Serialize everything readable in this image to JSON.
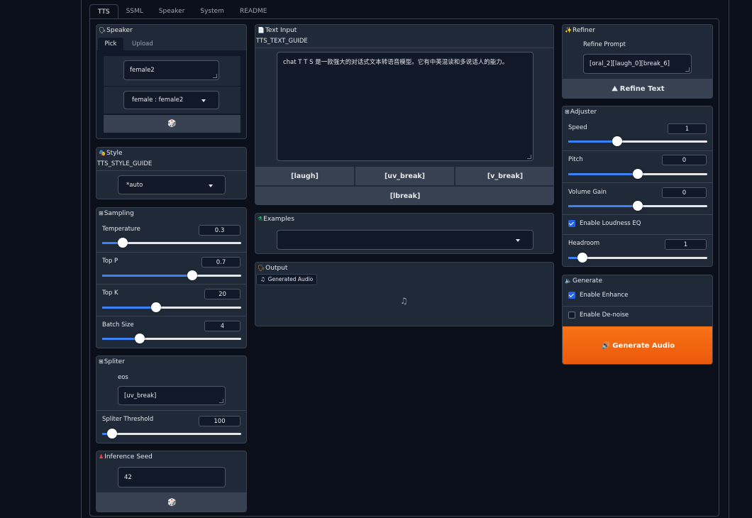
{
  "tabs": [
    "TTS",
    "SSML",
    "Speaker",
    "System",
    "README"
  ],
  "speaker": {
    "title": "Speaker",
    "subtabs": [
      "Pick",
      "Upload"
    ],
    "name_value": "female2",
    "select_value": "female : female2",
    "dice": "🎲"
  },
  "style": {
    "title": "Style",
    "guide": "TTS_STYLE_GUIDE",
    "select_value": "*auto"
  },
  "sampling": {
    "title": "Sampling",
    "temperature": {
      "label": "Temperature",
      "value": "0.3",
      "fraction": 0.15
    },
    "top_p": {
      "label": "Top P",
      "value": "0.7",
      "fraction": 0.65
    },
    "top_k": {
      "label": "Top K",
      "value": "20",
      "fraction": 0.39
    },
    "batch_size": {
      "label": "Batch Size",
      "value": "4",
      "fraction": 0.27
    }
  },
  "spliter": {
    "title": "Spliter",
    "eos_label": "eos",
    "eos_value": "[uv_break]",
    "threshold": {
      "label": "Spliter Threshold",
      "value": "100",
      "fraction": 0.07
    }
  },
  "inference_seed": {
    "title": "Inference Seed",
    "value": "42",
    "dice": "🎲"
  },
  "text_input": {
    "title": "Text Input",
    "guide": "TTS_TEXT_GUIDE",
    "value": "chat T T S 是一款强大的对话式文本转语音模型。它有中英混读和多说话人的能力。",
    "buttons": [
      "[laugh]",
      "[uv_break]",
      "[v_break]"
    ],
    "lbreak": "[lbreak]"
  },
  "examples": {
    "title": "Examples",
    "value": ""
  },
  "output": {
    "title": "Output",
    "audio_label": "Generated Audio"
  },
  "refiner": {
    "title": "Refiner",
    "prompt_label": "Refine Prompt",
    "prompt_value": "[oral_2][laugh_0][break_6]",
    "button": "Refine Text"
  },
  "adjuster": {
    "title": "Adjuster",
    "speed": {
      "label": "Speed",
      "value": "1",
      "fraction": 0.35
    },
    "pitch": {
      "label": "Pitch",
      "value": "0",
      "fraction": 0.5
    },
    "volume_gain": {
      "label": "Volume Gain",
      "value": "0",
      "fraction": 0.5
    },
    "loudness_eq": {
      "label": "Enable Loudness EQ",
      "checked": true
    },
    "headroom": {
      "label": "Headroom",
      "value": "1",
      "fraction": 0.1
    }
  },
  "generate": {
    "title": "Generate",
    "enhance": {
      "label": "Enable Enhance",
      "checked": true
    },
    "denoise": {
      "label": "Enable De-noise",
      "checked": false
    },
    "button": "Generate Audio"
  },
  "colors": {
    "accent": "#3b82f6",
    "primary_button": "#ea580c",
    "background": "#0b0f19",
    "panel": "#1f2937"
  }
}
